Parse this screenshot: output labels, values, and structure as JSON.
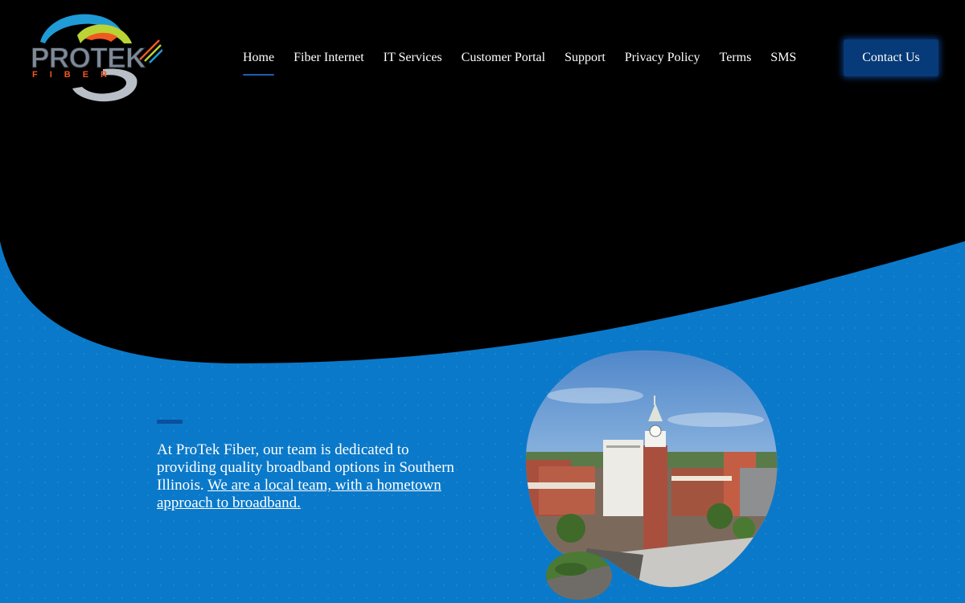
{
  "logo": {
    "brand_name": "PROTEK",
    "brand_sub": "FIBER"
  },
  "nav": {
    "items": [
      {
        "label": "Home",
        "active": true
      },
      {
        "label": "Fiber Internet",
        "active": false
      },
      {
        "label": "IT Services",
        "active": false
      },
      {
        "label": "Customer Portal",
        "active": false
      },
      {
        "label": "Support",
        "active": false
      },
      {
        "label": "Privacy Policy",
        "active": false
      },
      {
        "label": "Terms",
        "active": false
      },
      {
        "label": "SMS",
        "active": false
      }
    ],
    "contact_label": "Contact Us"
  },
  "intro": {
    "text": "At ProTek Fiber, our team is dedicated to providing quality broadband options in Southern Illinois. ",
    "link_text": "We are a local team, with a hometown approach to broadband."
  },
  "colors": {
    "background": "#000000",
    "brand_blue": "#0b79c9",
    "button_blue": "#073a78",
    "accent_orange": "#f0591f"
  }
}
